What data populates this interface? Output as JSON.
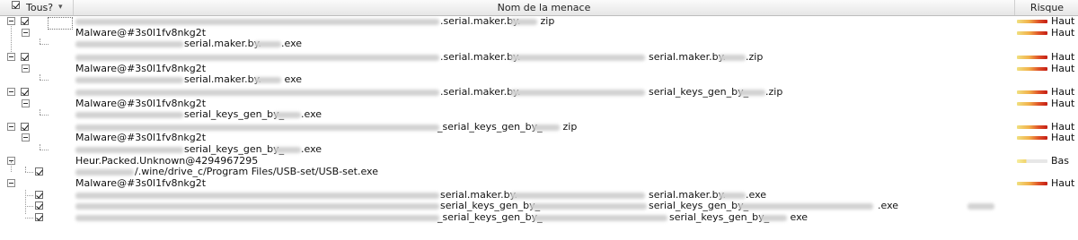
{
  "header": {
    "all_label": "Tous?",
    "sort_arrow": "▾",
    "column_name": "Nom de la menace",
    "column_risk": "Risque"
  },
  "risk_levels": {
    "high": "Haut",
    "low": "Bas"
  },
  "accent_colors": {
    "high_end": "#c41d14",
    "mid": "#f2b04a",
    "low_start": "#f0e080",
    "checkbox_border": "#6d6d6d"
  },
  "rows": [
    {
      "parts": [
        ".serial.maker.by.",
        " zip"
      ],
      "risk": "Haut"
    },
    {
      "name": "Malware@#3s0l1fv8nkg2t",
      "risk": "Haut"
    },
    {
      "parts": [
        "serial.maker.by.",
        ".exe"
      ]
    },
    {
      "parts": [
        ".serial.maker.by.",
        "serial.maker.by.",
        ".zip"
      ],
      "risk": "Haut"
    },
    {
      "name": "Malware@#3s0l1fv8nkg2t",
      "risk": "Haut"
    },
    {
      "parts": [
        "serial.maker.by.",
        " exe"
      ]
    },
    {
      "parts": [
        ".serial.maker.by.",
        "serial_keys_gen_by_",
        ".zip"
      ],
      "risk": "Haut"
    },
    {
      "name": "Malware@#3s0l1fv8nkg2t",
      "risk": "Haut"
    },
    {
      "parts": [
        "serial_keys_gen_by_",
        ".exe"
      ]
    },
    {
      "parts": [
        "_serial_keys_gen_by_",
        " zip"
      ],
      "risk": "Haut"
    },
    {
      "name": "Malware@#3s0l1fv8nkg2t",
      "risk": "Haut"
    },
    {
      "parts": [
        "serial_keys_gen_by_",
        ".exe"
      ]
    },
    {
      "name": "Heur.Packed.Unknown@4294967295",
      "risk": "Bas"
    },
    {
      "parts": [
        "/.wine/drive_c/Program Files/USB-set/USB-set.exe"
      ]
    },
    {
      "name": "Malware@#3s0l1fv8nkg2t",
      "risk": "Haut"
    },
    {
      "parts": [
        "serial.maker.by.",
        "serial.maker.by.",
        ".exe"
      ]
    },
    {
      "parts": [
        "serial_keys_gen_by_",
        "serial_keys_gen_by_",
        ".exe"
      ]
    },
    {
      "parts": [
        "_serial_keys_gen_by_",
        "serial_keys_gen_by_",
        " exe"
      ]
    }
  ]
}
